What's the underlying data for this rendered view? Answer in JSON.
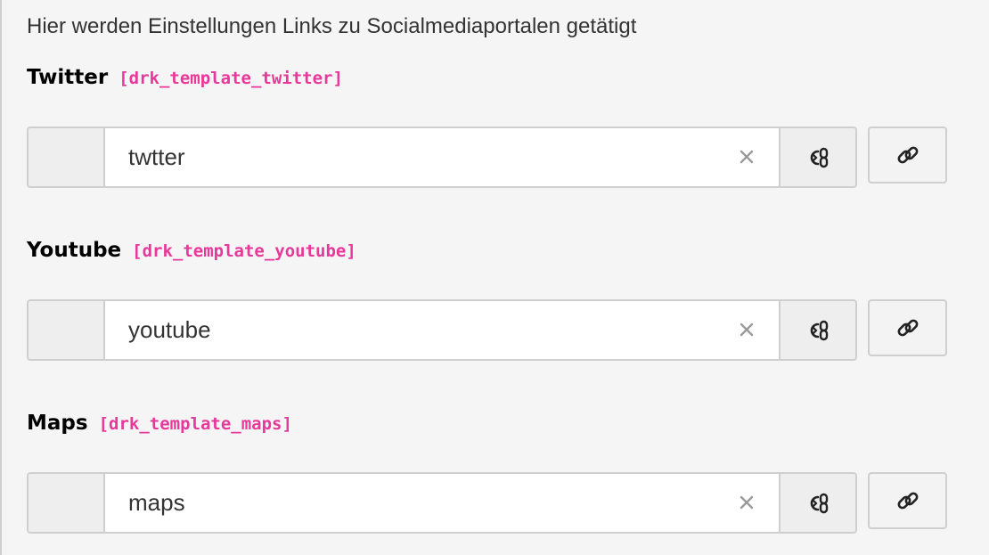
{
  "intro_text": "Hier werden Einstellungen Links zu Socialmediaportalen getätigt",
  "fields": [
    {
      "label": "Twitter",
      "code": "[drk_template_twitter]",
      "value": "twtter",
      "clear_icon": "close-icon",
      "status_icon": "broken-link-icon",
      "action_icon": "link-icon"
    },
    {
      "label": "Youtube",
      "code": "[drk_template_youtube]",
      "value": "youtube",
      "clear_icon": "close-icon",
      "status_icon": "broken-link-icon",
      "action_icon": "link-icon"
    },
    {
      "label": "Maps",
      "code": "[drk_template_maps]",
      "value": "maps",
      "clear_icon": "close-icon",
      "status_icon": "broken-link-icon",
      "action_icon": "link-icon"
    }
  ],
  "colors": {
    "code_accent": "#e8389a",
    "background": "#f5f5f5",
    "border": "#cfcfcf"
  }
}
